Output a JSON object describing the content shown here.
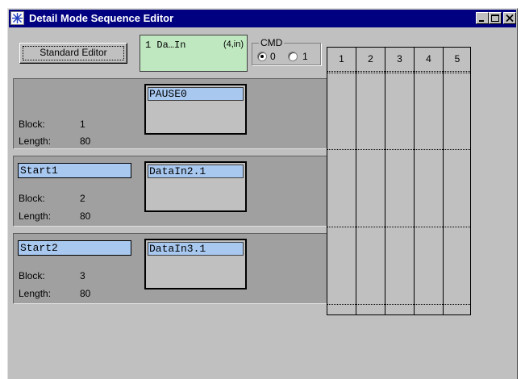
{
  "window": {
    "title": "Detail Mode Sequence Editor",
    "app_icon": "asterisk-snowflake-icon"
  },
  "toolbar": {
    "standard_editor_label": "Standard Editor",
    "selected_item_name": "1 Da…In",
    "selected_item_info": "(4,in)"
  },
  "cmd": {
    "legend": "CMD",
    "options": [
      "0",
      "1"
    ],
    "selected": "0"
  },
  "blocks": [
    {
      "start": "",
      "block_label": "Block:",
      "block_value": "1",
      "length_label": "Length:",
      "length_value": "80",
      "data": "PAUSE0"
    },
    {
      "start": "Start1",
      "block_label": "Block:",
      "block_value": "2",
      "length_label": "Length:",
      "length_value": "80",
      "data": "DataIn2.1"
    },
    {
      "start": "Start2",
      "block_label": "Block:",
      "block_value": "3",
      "length_label": "Length:",
      "length_value": "80",
      "data": "DataIn3.1"
    }
  ],
  "grid": {
    "columns": [
      "1",
      "2",
      "3",
      "4",
      "5"
    ]
  },
  "colors": {
    "title_bar": "#000080",
    "window_bg": "#c0c0c0",
    "block_bg": "#a0a0a0",
    "selected_item_bg": "#c0e8c0",
    "field_bg": "#a8c8f0"
  }
}
